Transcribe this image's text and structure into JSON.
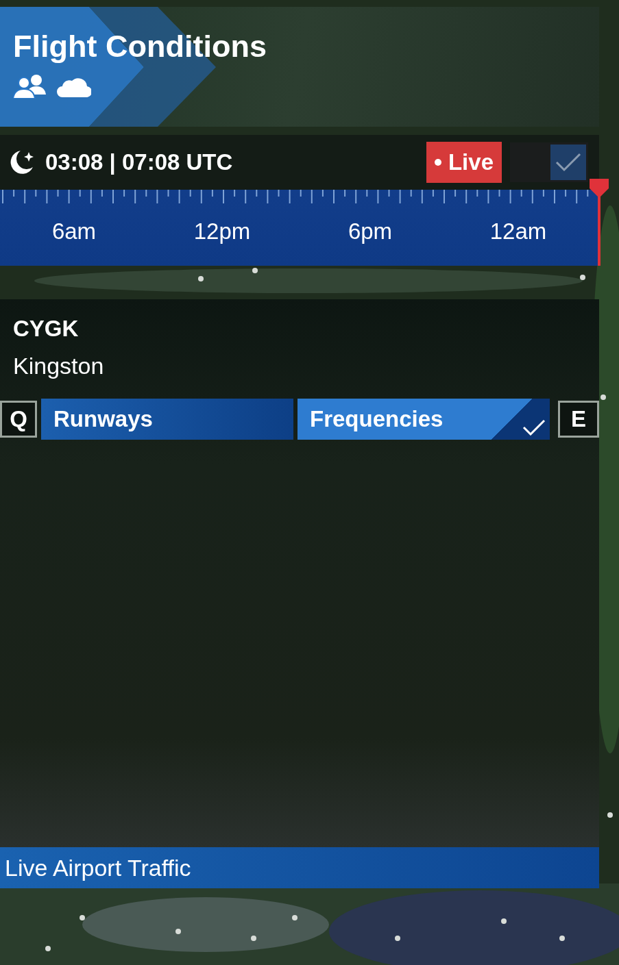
{
  "header": {
    "title": "Flight Conditions"
  },
  "time_bar": {
    "time": "03:08 | 07:08 UTC",
    "live_button": "Live",
    "toggle": {
      "checked": true
    }
  },
  "timeline": {
    "labels": [
      "6am",
      "12pm",
      "6pm",
      "12am"
    ],
    "level": 1
  },
  "airport": {
    "code": "CYGK",
    "name": "Kingston"
  },
  "tabs": [
    {
      "kind": "key",
      "label": "Q"
    },
    {
      "kind": "tab",
      "label": "Runways",
      "selected": false
    },
    {
      "kind": "tab",
      "label": "Frequencies",
      "selected": true
    },
    {
      "kind": "key",
      "label": "E"
    }
  ],
  "footer": {
    "title": "Live Airport Traffic"
  }
}
